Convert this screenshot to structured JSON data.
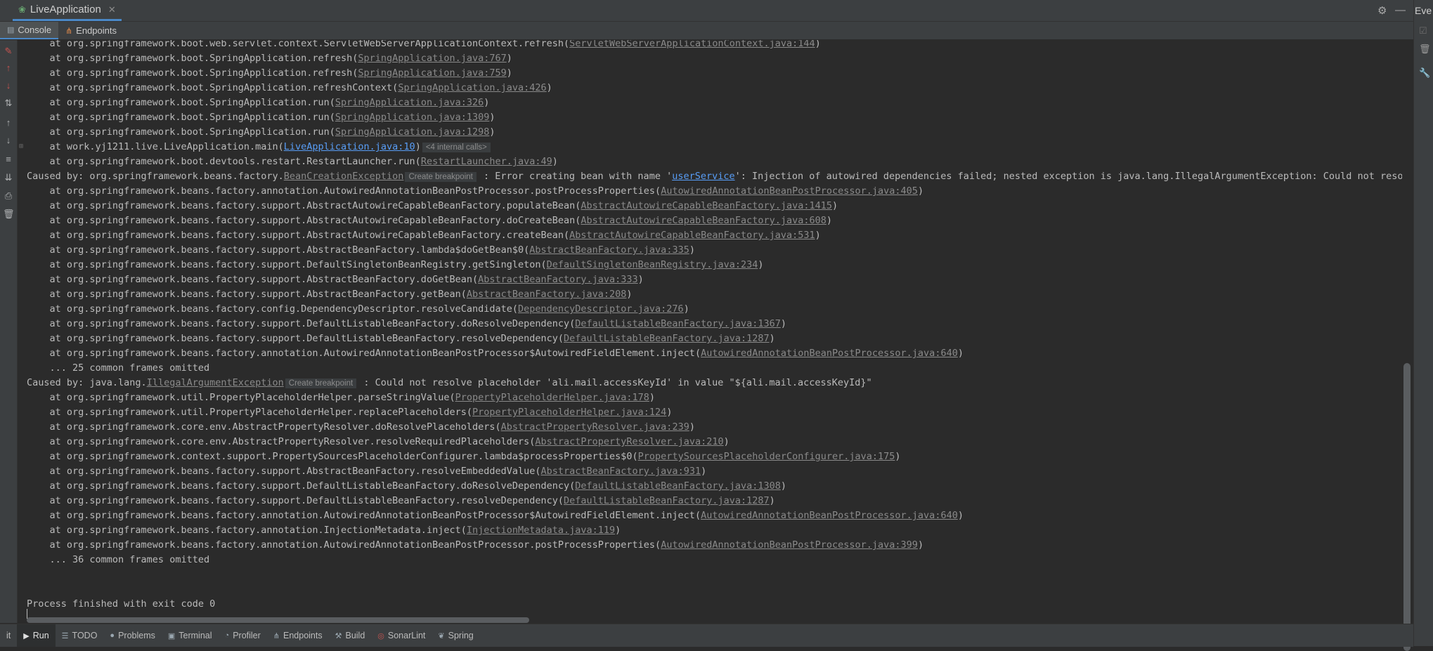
{
  "window": {
    "run_tab_title": "LiveApplication",
    "run_tab_close": "✕",
    "right_label": "Eve",
    "settings_glyph": "⚙",
    "minimize_glyph": "—"
  },
  "subtabs": [
    {
      "label": "Console",
      "icon": "console-icon"
    },
    {
      "label": "Endpoints",
      "icon": "endpoints-icon"
    }
  ],
  "console_lines": [
    {
      "kind": "at",
      "pre": "    at org.springframework.boot.web.servlet.context.ServletWebServerApplicationContext.refresh(",
      "link": "ServletWebServerApplicationContext.java:144",
      "post": ")"
    },
    {
      "kind": "at",
      "pre": "    at org.springframework.boot.SpringApplication.refresh(",
      "link": "SpringApplication.java:767",
      "post": ")"
    },
    {
      "kind": "at",
      "pre": "    at org.springframework.boot.SpringApplication.refresh(",
      "link": "SpringApplication.java:759",
      "post": ")"
    },
    {
      "kind": "at",
      "pre": "    at org.springframework.boot.SpringApplication.refreshContext(",
      "link": "SpringApplication.java:426",
      "post": ")"
    },
    {
      "kind": "at",
      "pre": "    at org.springframework.boot.SpringApplication.run(",
      "link": "SpringApplication.java:326",
      "post": ")"
    },
    {
      "kind": "at",
      "pre": "    at org.springframework.boot.SpringApplication.run(",
      "link": "SpringApplication.java:1309",
      "post": ")"
    },
    {
      "kind": "at",
      "pre": "    at org.springframework.boot.SpringApplication.run(",
      "link": "SpringApplication.java:1298",
      "post": ")"
    },
    {
      "kind": "main",
      "pre": "    at work.yj1211.live.LiveApplication.main(",
      "link": "LiveApplication.java:10",
      "post": ")",
      "hint": "<4 internal calls>"
    },
    {
      "kind": "at",
      "pre": "    at org.springframework.boot.devtools.restart.RestartLauncher.run(",
      "link": "RestartLauncher.java:49",
      "post": ")"
    },
    {
      "kind": "caused",
      "pre": "Caused by: org.springframework.beans.factory.",
      "link": "BeanCreationException",
      "hint": "Create breakpoint",
      "mid": " : Error creating bean with name '",
      "link2": "userService",
      "post": "': Injection of autowired dependencies failed; nested exception is java.lang.IllegalArgumentException: Could not resolve"
    },
    {
      "kind": "at",
      "pre": "    at org.springframework.beans.factory.annotation.AutowiredAnnotationBeanPostProcessor.postProcessProperties(",
      "link": "AutowiredAnnotationBeanPostProcessor.java:405",
      "post": ")"
    },
    {
      "kind": "at",
      "pre": "    at org.springframework.beans.factory.support.AbstractAutowireCapableBeanFactory.populateBean(",
      "link": "AbstractAutowireCapableBeanFactory.java:1415",
      "post": ")"
    },
    {
      "kind": "at",
      "pre": "    at org.springframework.beans.factory.support.AbstractAutowireCapableBeanFactory.doCreateBean(",
      "link": "AbstractAutowireCapableBeanFactory.java:608",
      "post": ")"
    },
    {
      "kind": "at",
      "pre": "    at org.springframework.beans.factory.support.AbstractAutowireCapableBeanFactory.createBean(",
      "link": "AbstractAutowireCapableBeanFactory.java:531",
      "post": ")"
    },
    {
      "kind": "at",
      "pre": "    at org.springframework.beans.factory.support.AbstractBeanFactory.lambda$doGetBean$0(",
      "link": "AbstractBeanFactory.java:335",
      "post": ")"
    },
    {
      "kind": "at",
      "pre": "    at org.springframework.beans.factory.support.DefaultSingletonBeanRegistry.getSingleton(",
      "link": "DefaultSingletonBeanRegistry.java:234",
      "post": ")"
    },
    {
      "kind": "at",
      "pre": "    at org.springframework.beans.factory.support.AbstractBeanFactory.doGetBean(",
      "link": "AbstractBeanFactory.java:333",
      "post": ")"
    },
    {
      "kind": "at",
      "pre": "    at org.springframework.beans.factory.support.AbstractBeanFactory.getBean(",
      "link": "AbstractBeanFactory.java:208",
      "post": ")"
    },
    {
      "kind": "at",
      "pre": "    at org.springframework.beans.factory.config.DependencyDescriptor.resolveCandidate(",
      "link": "DependencyDescriptor.java:276",
      "post": ")"
    },
    {
      "kind": "at",
      "pre": "    at org.springframework.beans.factory.support.DefaultListableBeanFactory.doResolveDependency(",
      "link": "DefaultListableBeanFactory.java:1367",
      "post": ")"
    },
    {
      "kind": "at",
      "pre": "    at org.springframework.beans.factory.support.DefaultListableBeanFactory.resolveDependency(",
      "link": "DefaultListableBeanFactory.java:1287",
      "post": ")"
    },
    {
      "kind": "at",
      "pre": "    at org.springframework.beans.factory.annotation.AutowiredAnnotationBeanPostProcessor$AutowiredFieldElement.inject(",
      "link": "AutowiredAnnotationBeanPostProcessor.java:640",
      "post": ")"
    },
    {
      "kind": "plain",
      "pre": "    ... 25 common frames omitted"
    },
    {
      "kind": "caused",
      "pre": "Caused by: java.lang.",
      "link": "IllegalArgumentException",
      "hint": "Create breakpoint",
      "mid": " : Could not resolve placeholder 'ali.mail.accessKeyId' in value \"${ali.mail.accessKeyId}\"",
      "link2": "",
      "post": ""
    },
    {
      "kind": "at",
      "pre": "    at org.springframework.util.PropertyPlaceholderHelper.parseStringValue(",
      "link": "PropertyPlaceholderHelper.java:178",
      "post": ")"
    },
    {
      "kind": "at",
      "pre": "    at org.springframework.util.PropertyPlaceholderHelper.replacePlaceholders(",
      "link": "PropertyPlaceholderHelper.java:124",
      "post": ")"
    },
    {
      "kind": "at",
      "pre": "    at org.springframework.core.env.AbstractPropertyResolver.doResolvePlaceholders(",
      "link": "AbstractPropertyResolver.java:239",
      "post": ")"
    },
    {
      "kind": "at",
      "pre": "    at org.springframework.core.env.AbstractPropertyResolver.resolveRequiredPlaceholders(",
      "link": "AbstractPropertyResolver.java:210",
      "post": ")"
    },
    {
      "kind": "at",
      "pre": "    at org.springframework.context.support.PropertySourcesPlaceholderConfigurer.lambda$processProperties$0(",
      "link": "PropertySourcesPlaceholderConfigurer.java:175",
      "post": ")"
    },
    {
      "kind": "at",
      "pre": "    at org.springframework.beans.factory.support.AbstractBeanFactory.resolveEmbeddedValue(",
      "link": "AbstractBeanFactory.java:931",
      "post": ")"
    },
    {
      "kind": "at",
      "pre": "    at org.springframework.beans.factory.support.DefaultListableBeanFactory.doResolveDependency(",
      "link": "DefaultListableBeanFactory.java:1308",
      "post": ")"
    },
    {
      "kind": "at",
      "pre": "    at org.springframework.beans.factory.support.DefaultListableBeanFactory.resolveDependency(",
      "link": "DefaultListableBeanFactory.java:1287",
      "post": ")"
    },
    {
      "kind": "at",
      "pre": "    at org.springframework.beans.factory.annotation.AutowiredAnnotationBeanPostProcessor$AutowiredFieldElement.inject(",
      "link": "AutowiredAnnotationBeanPostProcessor.java:640",
      "post": ")"
    },
    {
      "kind": "at",
      "pre": "    at org.springframework.beans.factory.annotation.InjectionMetadata.inject(",
      "link": "InjectionMetadata.java:119",
      "post": ")"
    },
    {
      "kind": "at",
      "pre": "    at org.springframework.beans.factory.annotation.AutowiredAnnotationBeanPostProcessor.postProcessProperties(",
      "link": "AutowiredAnnotationBeanPostProcessor.java:399",
      "post": ")"
    },
    {
      "kind": "plain",
      "pre": "    ... 36 common frames omitted"
    },
    {
      "kind": "plain",
      "pre": ""
    },
    {
      "kind": "plain",
      "pre": ""
    },
    {
      "kind": "plain",
      "pre": "Process finished with exit code 0"
    }
  ],
  "left_toolbar": [
    {
      "icon": "rerun-icon",
      "glyph": "✎"
    },
    {
      "icon": "up-arrow-icon",
      "glyph": "↑"
    },
    {
      "icon": "down-arrow-icon",
      "glyph": "↓"
    },
    {
      "icon": "sort-icon",
      "glyph": "⇅"
    },
    {
      "icon": "prev-occurrence-icon",
      "glyph": "↑"
    },
    {
      "icon": "next-occurrence-icon",
      "glyph": "↓"
    },
    {
      "icon": "soft-wrap-icon",
      "glyph": "≡"
    },
    {
      "icon": "scroll-to-end-icon",
      "glyph": "⇊"
    },
    {
      "icon": "print-icon",
      "glyph": "⎙"
    },
    {
      "icon": "clear-all-icon",
      "glyph": "🗑"
    }
  ],
  "bottom_tools": [
    {
      "label": "it",
      "icon": "",
      "active": false
    },
    {
      "label": "Run",
      "icon": "▶",
      "active": true
    },
    {
      "label": "TODO",
      "icon": "☰",
      "active": false
    },
    {
      "label": "Problems",
      "icon": "●",
      "active": false
    },
    {
      "label": "Terminal",
      "icon": "▣",
      "active": false
    },
    {
      "label": "Profiler",
      "icon": "◔",
      "active": false
    },
    {
      "label": "Endpoints",
      "icon": "⋔",
      "active": false
    },
    {
      "label": "Build",
      "icon": "⚒",
      "active": false
    },
    {
      "label": "SonarLint",
      "icon": "◎",
      "active": false
    },
    {
      "label": "Spring",
      "icon": "❦",
      "active": false
    }
  ],
  "colors": {
    "background": "#2b2b2b",
    "panel": "#3c3f41",
    "link_gray": "#8a8a8a",
    "link_blue": "#589df6",
    "accent": "#4a88c7",
    "stop_red": "#c75450"
  }
}
